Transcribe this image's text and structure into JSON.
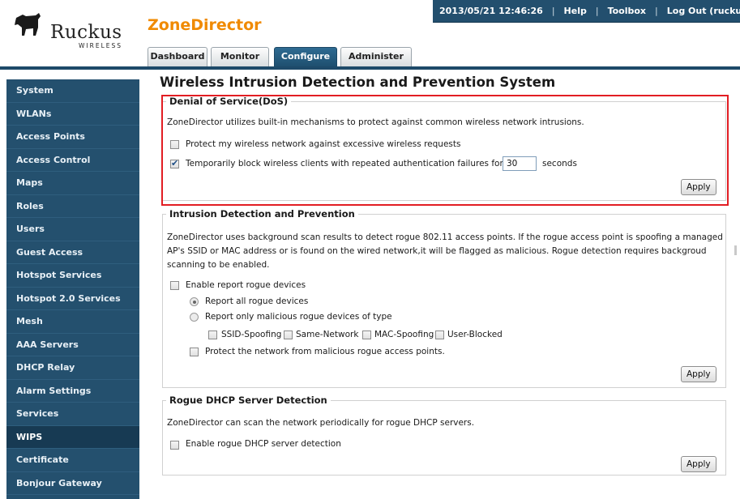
{
  "brand": {
    "logo_text": "Ruckus",
    "logo_subtext": "WIRELESS",
    "product": "ZoneDirector"
  },
  "topbar": {
    "datetime": "2013/05/21 12:46:26",
    "separator": "|",
    "help": "Help",
    "toolbox": "Toolbox",
    "logout": "Log Out (ruckus)"
  },
  "tabs": [
    "Dashboard",
    "Monitor",
    "Configure",
    "Administer"
  ],
  "active_tab": "Configure",
  "sidebar": {
    "items": [
      "System",
      "WLANs",
      "Access Points",
      "Access Control",
      "Maps",
      "Roles",
      "Users",
      "Guest Access",
      "Hotspot Services",
      "Hotspot 2.0 Services",
      "Mesh",
      "AAA Servers",
      "DHCP Relay",
      "Alarm Settings",
      "Services",
      "WIPS",
      "Certificate",
      "Bonjour Gateway"
    ],
    "active": "WIPS"
  },
  "page": {
    "title": "Wireless Intrusion Detection and Prevention System"
  },
  "dos": {
    "legend": "Denial of Service(DoS)",
    "description": "ZoneDirector utilizes built-in mechanisms to protect against common wireless network intrusions.",
    "protect_label": "Protect my wireless network against excessive wireless requests",
    "protect_checked": false,
    "block_label": "Temporarily block wireless clients with repeated authentication failures for",
    "block_checked": true,
    "block_value": "30",
    "block_unit": "seconds",
    "apply": "Apply"
  },
  "idp": {
    "legend": "Intrusion Detection and Prevention",
    "description": "ZoneDirector uses background scan results to detect rogue 802.11 access points. If the rogue access point is spoofing a managed AP's SSID or MAC address or is found on the wired network,it will be flagged as malicious. Rogue detection requires backgroud scanning to be enabled.",
    "enable_report_label": "Enable report rogue devices",
    "enable_report_checked": false,
    "report_all_label": "Report all rogue devices",
    "report_all_selected": true,
    "report_malicious_label": "Report only malicious rogue devices of type",
    "report_malicious_selected": false,
    "types": [
      {
        "label": "SSID-Spoofing",
        "checked": false
      },
      {
        "label": "Same-Network",
        "checked": false
      },
      {
        "label": "MAC-Spoofing",
        "checked": false
      },
      {
        "label": "User-Blocked",
        "checked": false
      }
    ],
    "protect_network_label": "Protect the network from malicious rogue access points.",
    "protect_network_checked": false,
    "apply": "Apply"
  },
  "dhcp": {
    "legend": "Rogue DHCP Server Detection",
    "description": "ZoneDirector can scan the network periodically for rogue DHCP servers.",
    "enable_label": "Enable rogue DHCP server detection",
    "enable_checked": false,
    "apply": "Apply"
  },
  "colors": {
    "accent_orange": "#f08a00",
    "nav_blue": "#24506e",
    "highlight_red": "#e21d23"
  }
}
